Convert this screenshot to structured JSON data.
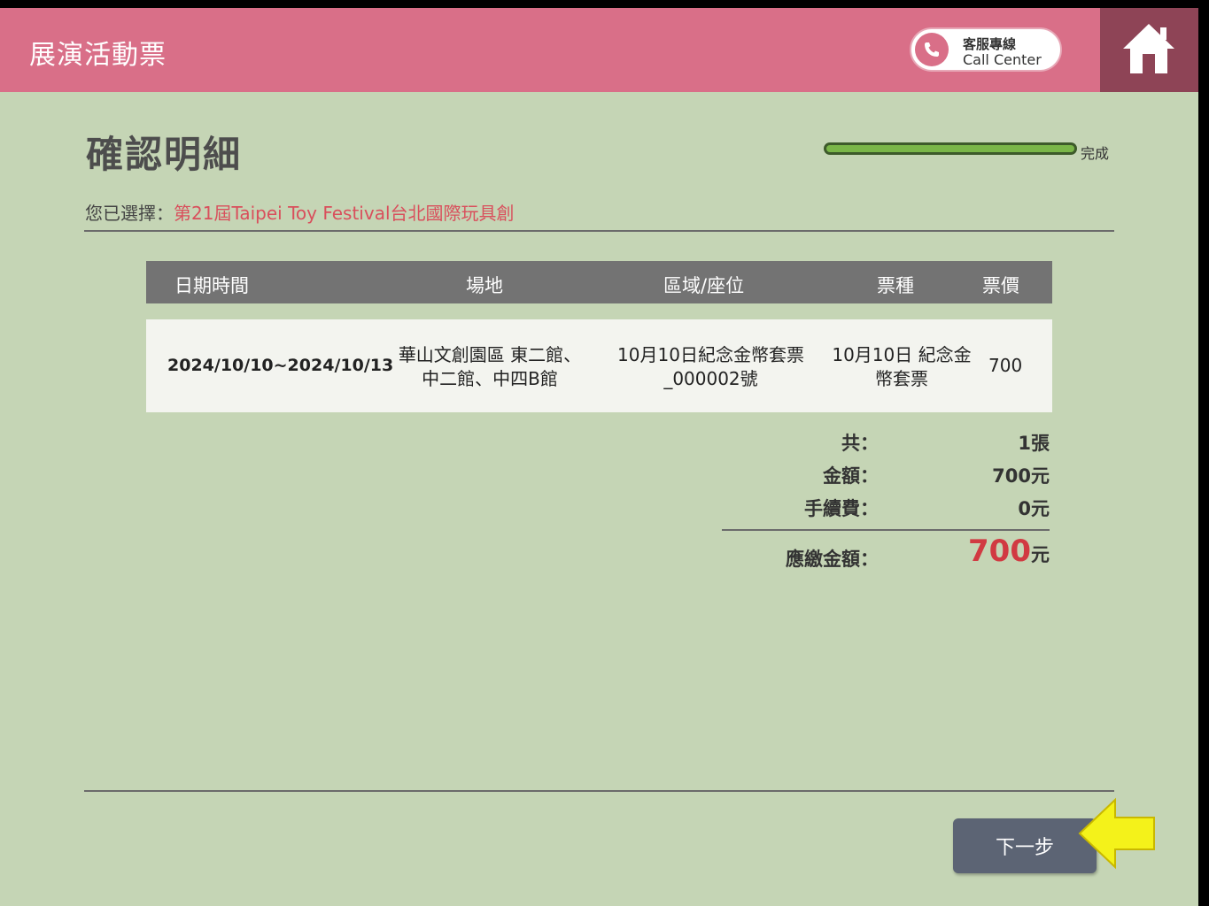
{
  "header": {
    "title": "展演活動票",
    "call_center_line1": "客服專線",
    "call_center_line2": "Call Center",
    "home_icon": "home-icon",
    "phone_icon": "phone-icon"
  },
  "page": {
    "title": "確認明細",
    "progress_label": "完成",
    "progress_fraction": 1.0,
    "selected_prefix": "您已選擇：",
    "selected_value": "第21屆Taipei Toy Festival台北國際玩具創"
  },
  "table": {
    "headers": [
      "日期時間",
      "場地",
      "區域/座位",
      "票種",
      "票價"
    ],
    "row": {
      "datetime": "2024/10/10~2024/10/13",
      "venue_line1": "華山文創園區 東二館、",
      "venue_line2": "中二館、中四B館",
      "area_line1": "10月10日紀念金幣套票",
      "area_line2": "_000002號",
      "type_line1": "10月10日 紀念金",
      "type_line2": "幣套票",
      "price": "700"
    }
  },
  "summary": {
    "count_label": "共：",
    "count_value": "1張",
    "amount_label": "金額：",
    "amount_value": "700元",
    "fee_label": "手續費：",
    "fee_value": "0元",
    "total_label": "應繳金額：",
    "total_amount": "700",
    "total_unit": "元"
  },
  "actions": {
    "next_label": "下一步"
  },
  "colors": {
    "header_bg": "#d96f88",
    "page_bg": "#c5d5b5",
    "accent_red": "#d13a42",
    "button_bg": "#5c6474",
    "arrow": "#f4f21a"
  }
}
